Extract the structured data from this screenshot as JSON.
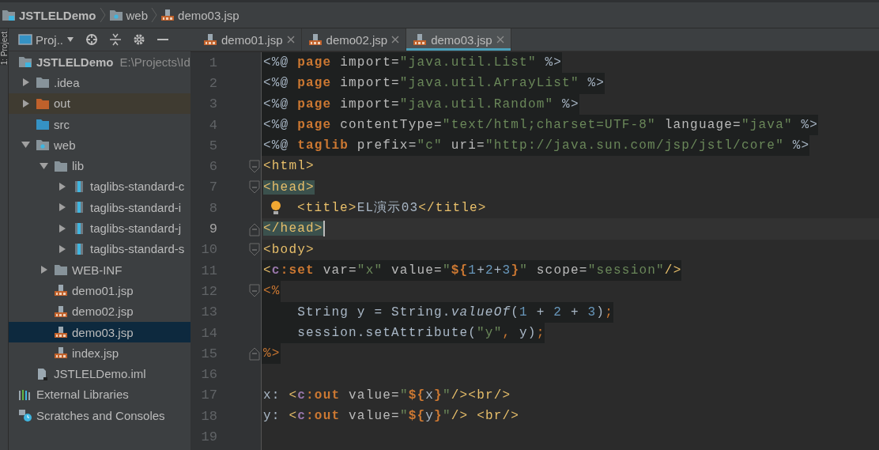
{
  "breadcrumb": [
    {
      "label": "JSTLELDemo",
      "kind": "project"
    },
    {
      "label": "web",
      "kind": "web-folder"
    },
    {
      "label": "demo03.jsp",
      "kind": "jsp"
    }
  ],
  "tool_strip": {
    "label": "1: Project"
  },
  "project_panel": {
    "view_selector": "Proj..",
    "tree": [
      {
        "label": "JSTLELDemo",
        "kind": "project",
        "detail": "E:\\Projects\\Id",
        "selected": false,
        "children": [
          {
            "label": ".idea",
            "kind": "folder",
            "expanded": false,
            "selected": false
          },
          {
            "label": "out",
            "kind": "excluded-folder",
            "expanded": false,
            "selected": false
          },
          {
            "label": "src",
            "kind": "source-folder",
            "selected": false
          },
          {
            "label": "web",
            "kind": "web-folder",
            "expanded": true,
            "selected": false,
            "children": [
              {
                "label": "lib",
                "kind": "folder",
                "expanded": true,
                "selected": false,
                "children": [
                  {
                    "label": "taglibs-standard-c",
                    "kind": "jar",
                    "expanded": false,
                    "selected": false
                  },
                  {
                    "label": "taglibs-standard-i",
                    "kind": "jar",
                    "expanded": false,
                    "selected": false
                  },
                  {
                    "label": "taglibs-standard-j",
                    "kind": "jar",
                    "expanded": false,
                    "selected": false
                  },
                  {
                    "label": "taglibs-standard-s",
                    "kind": "jar",
                    "expanded": false,
                    "selected": false
                  }
                ]
              },
              {
                "label": "WEB-INF",
                "kind": "folder",
                "expanded": false,
                "selected": false
              },
              {
                "label": "demo01.jsp",
                "kind": "jsp",
                "selected": false
              },
              {
                "label": "demo02.jsp",
                "kind": "jsp",
                "selected": false
              },
              {
                "label": "demo03.jsp",
                "kind": "jsp",
                "selected": true
              },
              {
                "label": "index.jsp",
                "kind": "jsp",
                "selected": false
              }
            ]
          },
          {
            "label": "JSTLELDemo.iml",
            "kind": "iml",
            "selected": false
          }
        ]
      },
      {
        "label": "External Libraries",
        "kind": "libraries",
        "selected": false
      },
      {
        "label": "Scratches and Consoles",
        "kind": "scratches",
        "selected": false
      }
    ]
  },
  "tabs": [
    {
      "label": "demo01.jsp",
      "selected": false
    },
    {
      "label": "demo02.jsp",
      "selected": false
    },
    {
      "label": "demo03.jsp",
      "selected": true
    }
  ],
  "editor": {
    "lines": [
      {
        "number": "1",
        "shaded": true,
        "tokens": [
          {
            "text": "<%@ ",
            "kind": "punct"
          },
          {
            "text": "page",
            "kind": "kw"
          },
          {
            "text": " import=",
            "kind": "attr"
          },
          {
            "text": "\"java.util.List\"",
            "kind": "str"
          },
          {
            "text": " %>",
            "kind": "punct"
          }
        ]
      },
      {
        "number": "2",
        "shaded": true,
        "tokens": [
          {
            "text": "<%@ ",
            "kind": "punct"
          },
          {
            "text": "page",
            "kind": "kw"
          },
          {
            "text": " import=",
            "kind": "attr"
          },
          {
            "text": "\"java.util.ArrayList\"",
            "kind": "str"
          },
          {
            "text": " %>",
            "kind": "punct"
          }
        ]
      },
      {
        "number": "3",
        "shaded": true,
        "tokens": [
          {
            "text": "<%@ ",
            "kind": "punct"
          },
          {
            "text": "page",
            "kind": "kw"
          },
          {
            "text": " import=",
            "kind": "attr"
          },
          {
            "text": "\"java.util.Random\"",
            "kind": "str"
          },
          {
            "text": " %>",
            "kind": "punct"
          }
        ]
      },
      {
        "number": "4",
        "shaded": true,
        "tokens": [
          {
            "text": "<%@ ",
            "kind": "punct"
          },
          {
            "text": "page",
            "kind": "kw"
          },
          {
            "text": " contentType=",
            "kind": "attr"
          },
          {
            "text": "\"text/html;charset=UTF-8\"",
            "kind": "str"
          },
          {
            "text": " language=",
            "kind": "attr"
          },
          {
            "text": "\"java\"",
            "kind": "str"
          },
          {
            "text": " %>",
            "kind": "punct"
          }
        ]
      },
      {
        "number": "5",
        "shaded": true,
        "tokens": [
          {
            "text": "<%@ ",
            "kind": "punct"
          },
          {
            "text": "taglib",
            "kind": "kw"
          },
          {
            "text": " prefix=",
            "kind": "attr"
          },
          {
            "text": "\"c\"",
            "kind": "str"
          },
          {
            "text": " uri=",
            "kind": "attr"
          },
          {
            "text": "\"http://java.sun.com/jsp/jstl/core\"",
            "kind": "str"
          },
          {
            "text": " %>",
            "kind": "punct"
          }
        ]
      },
      {
        "number": "6",
        "fold_start": true,
        "tokens": [
          {
            "text": "<html>",
            "kind": "tag"
          }
        ]
      },
      {
        "number": "7",
        "fold_start": true,
        "tokens": [
          {
            "text": "<head>",
            "kind": "tag-match"
          }
        ]
      },
      {
        "number": "8",
        "bulb": true,
        "tokens": [
          {
            "text": "<title>",
            "kind": "tag"
          },
          {
            "text": "EL演示03",
            "kind": "plain"
          },
          {
            "text": "</title>",
            "kind": "tag"
          }
        ]
      },
      {
        "number": "9",
        "current": true,
        "fold_end": true,
        "tokens": [
          {
            "text": "</head>",
            "kind": "tag-match"
          }
        ]
      },
      {
        "number": "10",
        "fold_start": true,
        "tokens": [
          {
            "text": "<body>",
            "kind": "tag"
          }
        ]
      },
      {
        "number": "11",
        "shaded": true,
        "tokens": [
          {
            "text": "<",
            "kind": "tag"
          },
          {
            "text": "c",
            "kind": "ns"
          },
          {
            "text": ":set",
            "kind": "ctag"
          },
          {
            "text": " var=",
            "kind": "attr"
          },
          {
            "text": "\"x\"",
            "kind": "str"
          },
          {
            "text": " value=",
            "kind": "attr"
          },
          {
            "text": "\"",
            "kind": "str"
          },
          {
            "text": "${",
            "kind": "el"
          },
          {
            "text": "1",
            "kind": "num"
          },
          {
            "text": "+",
            "kind": "plain"
          },
          {
            "text": "2",
            "kind": "num"
          },
          {
            "text": "+",
            "kind": "plain"
          },
          {
            "text": "3",
            "kind": "num"
          },
          {
            "text": "}",
            "kind": "el"
          },
          {
            "text": "\"",
            "kind": "str"
          },
          {
            "text": " scope=",
            "kind": "attr"
          },
          {
            "text": "\"session\"",
            "kind": "str"
          },
          {
            "text": "/>",
            "kind": "tag"
          }
        ]
      },
      {
        "number": "12",
        "shaded": true,
        "fold_start": true,
        "tokens": [
          {
            "text": "<%",
            "kind": "delim"
          }
        ]
      },
      {
        "number": "13",
        "shaded": true,
        "tokens": [
          {
            "text": "    String y = String.",
            "kind": "plain"
          },
          {
            "text": "valueOf",
            "kind": "italic"
          },
          {
            "text": "(",
            "kind": "plain"
          },
          {
            "text": "1",
            "kind": "num"
          },
          {
            "text": " + ",
            "kind": "plain"
          },
          {
            "text": "2",
            "kind": "num"
          },
          {
            "text": " + ",
            "kind": "plain"
          },
          {
            "text": "3",
            "kind": "num"
          },
          {
            "text": ")",
            "kind": "plain"
          },
          {
            "text": ";",
            "kind": "delim"
          }
        ]
      },
      {
        "number": "14",
        "shaded": true,
        "tokens": [
          {
            "text": "    session.setAttribute(",
            "kind": "plain"
          },
          {
            "text": "\"y\"",
            "kind": "str"
          },
          {
            "text": ",",
            "kind": "delim"
          },
          {
            "text": " y)",
            "kind": "plain"
          },
          {
            "text": ";",
            "kind": "delim"
          }
        ]
      },
      {
        "number": "15",
        "shaded": true,
        "fold_end": true,
        "tokens": [
          {
            "text": "%>",
            "kind": "delim"
          }
        ]
      },
      {
        "number": "16"
      },
      {
        "number": "17",
        "tokens": [
          {
            "text": "x: ",
            "kind": "plain"
          },
          {
            "text": "<",
            "kind": "tag"
          },
          {
            "text": "c",
            "kind": "ns"
          },
          {
            "text": ":out",
            "kind": "ctag"
          },
          {
            "text": " value=",
            "kind": "attr"
          },
          {
            "text": "\"",
            "kind": "str"
          },
          {
            "text": "${",
            "kind": "el"
          },
          {
            "text": "x",
            "kind": "plain"
          },
          {
            "text": "}",
            "kind": "el"
          },
          {
            "text": "\"",
            "kind": "str"
          },
          {
            "text": "/>",
            "kind": "tag"
          },
          {
            "text": "<br/>",
            "kind": "tag"
          }
        ]
      },
      {
        "number": "18",
        "tokens": [
          {
            "text": "y: ",
            "kind": "plain"
          },
          {
            "text": "<",
            "kind": "tag"
          },
          {
            "text": "c",
            "kind": "ns"
          },
          {
            "text": ":out",
            "kind": "ctag"
          },
          {
            "text": " value=",
            "kind": "attr"
          },
          {
            "text": "\"",
            "kind": "str"
          },
          {
            "text": "${",
            "kind": "el"
          },
          {
            "text": "y",
            "kind": "plain"
          },
          {
            "text": "}",
            "kind": "el"
          },
          {
            "text": "\"",
            "kind": "str"
          },
          {
            "text": "/>",
            "kind": "tag"
          },
          {
            "text": " <br/>",
            "kind": "tag"
          }
        ]
      },
      {
        "number": "19"
      }
    ]
  }
}
